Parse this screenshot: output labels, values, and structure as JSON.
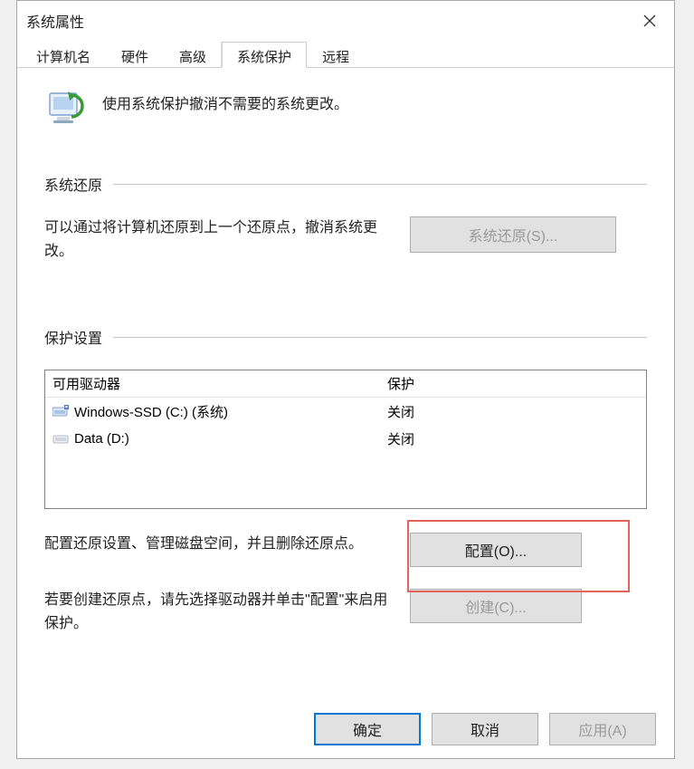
{
  "window": {
    "title": "系统属性"
  },
  "tabs": [
    {
      "label": "计算机名"
    },
    {
      "label": "硬件"
    },
    {
      "label": "高级"
    },
    {
      "label": "系统保护",
      "active": true
    },
    {
      "label": "远程"
    }
  ],
  "intro": "使用系统保护撤消不需要的系统更改。",
  "section_restore": {
    "label": "系统还原",
    "desc": "可以通过将计算机还原到上一个还原点，撤消系统更改。",
    "button": "系统还原(S)..."
  },
  "section_protect": {
    "label": "保护设置",
    "columns": {
      "drive": "可用驱动器",
      "protection": "保护"
    },
    "drives": [
      {
        "name": "Windows-SSD (C:) (系统)",
        "protection": "关闭",
        "icon": "system"
      },
      {
        "name": "Data (D:)",
        "protection": "关闭",
        "icon": "data"
      }
    ],
    "config_desc": "配置还原设置、管理磁盘空间，并且删除还原点。",
    "config_button": "配置(O)...",
    "create_desc": "若要创建还原点，请先选择驱动器并单击\"配置\"来启用保护。",
    "create_button": "创建(C)..."
  },
  "footer": {
    "ok": "确定",
    "cancel": "取消",
    "apply": "应用(A)"
  }
}
